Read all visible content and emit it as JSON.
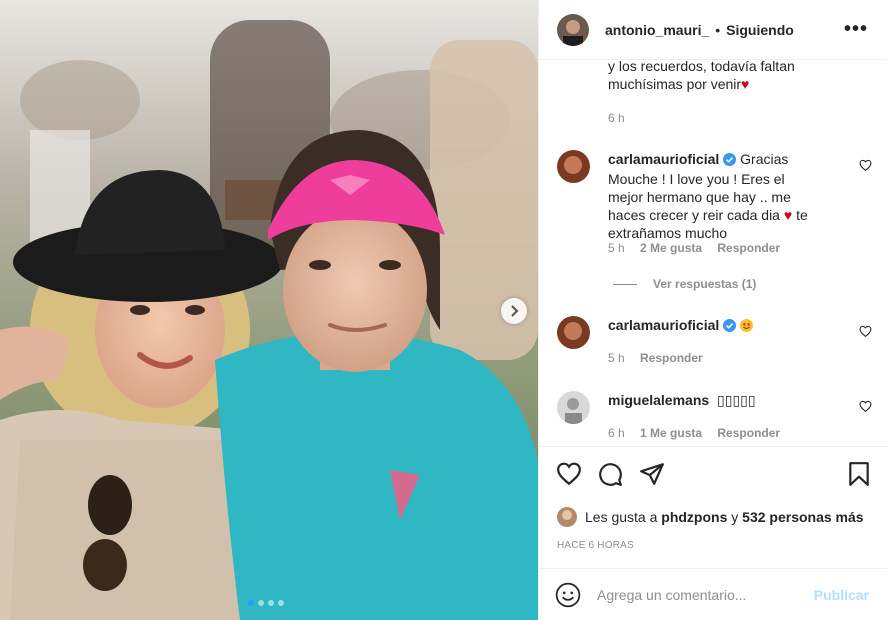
{
  "header": {
    "username": "antonio_mauri_",
    "separator": "•",
    "follow_status": "Siguiendo",
    "more_label": "•••"
  },
  "caption_tail": {
    "text_html_line1": "y los recuerdos, todavía faltan",
    "text_html_line2": "muchísimas por venir",
    "time": "6 h"
  },
  "comments": [
    {
      "username": "carlamaurioficial",
      "verified": true,
      "text": "Gracias Mouche ! I love you ! Eres el mejor hermano que hay .. me haces crecer y reir cada dia",
      "text_end": "te extrañamos mucho",
      "time": "5 h",
      "likes": "2 Me gusta",
      "reply": "Responder"
    },
    {
      "username": "carlamaurioficial",
      "verified": true,
      "text": "",
      "time": "5 h",
      "reply": "Responder"
    },
    {
      "username": "miguelalemans",
      "verified": false,
      "text": "▯▯▯▯▯",
      "time": "6 h",
      "likes": "1 Me gusta",
      "reply": "Responder"
    }
  ],
  "view_replies": "Ver respuestas (1)",
  "likes_line": {
    "prefix": "Les gusta a",
    "user": "phdzpons",
    "conj": "y",
    "others": "532 personas más"
  },
  "posted_time": "HACE 6 HORAS",
  "comment_box": {
    "placeholder": "Agrega un comentario...",
    "publish": "Publicar"
  },
  "carousel": {
    "count": 4,
    "active": 0
  },
  "colors": {
    "verified": "#3897f0",
    "heart_red": "#ed4956",
    "publish_disabled": "#b2dffc",
    "link_blue": "#2f96ff"
  },
  "icons": [
    "heart-icon",
    "comment-icon",
    "share-icon",
    "bookmark-icon",
    "emoji-icon",
    "chevron-right-icon",
    "more-icon",
    "verified-icon"
  ]
}
